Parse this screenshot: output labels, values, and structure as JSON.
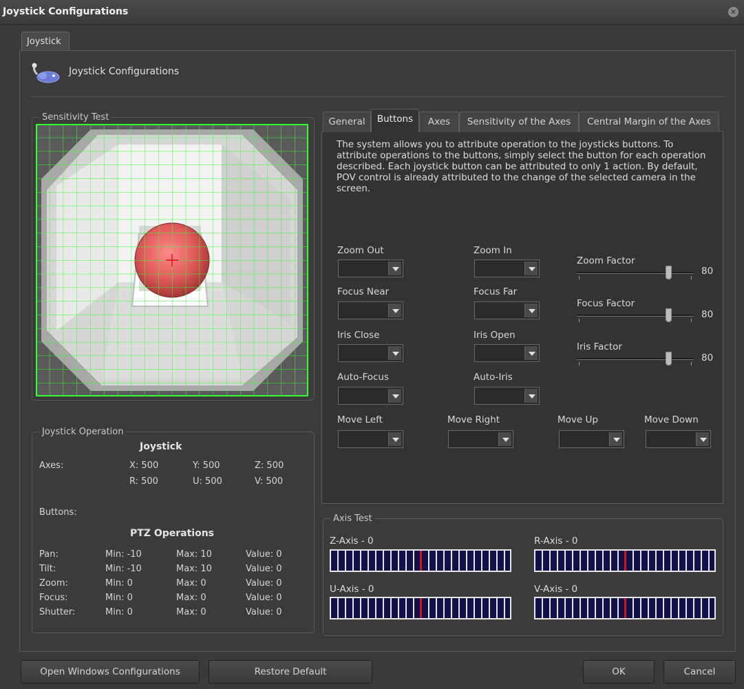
{
  "window": {
    "title": "Joystick Configurations"
  },
  "outer_tab": {
    "label": "Joystick"
  },
  "header": {
    "label": "Joystick Configurations",
    "icon": "joystick-icon"
  },
  "sensitivity": {
    "legend": "Sensitivity Test",
    "grid_color": "#33ff33",
    "cursor_color": "#e85555"
  },
  "operation": {
    "legend": "Joystick Operation",
    "joystick_heading": "Joystick",
    "axes_label": "Axes:",
    "axes": {
      "x": "X: 500",
      "y": "Y: 500",
      "z": "Z: 500",
      "r": "R: 500",
      "u": "U: 500",
      "v": "V: 500"
    },
    "buttons_label": "Buttons:",
    "ptz_heading": "PTZ Operations",
    "ptz_rows": [
      {
        "name": "Pan:",
        "min": "Min: -10",
        "max": "Max: 10",
        "value": "Value: 0"
      },
      {
        "name": "Tilt:",
        "min": "Min: -10",
        "max": "Max: 10",
        "value": "Value: 0"
      },
      {
        "name": "Zoom:",
        "min": "Min: 0",
        "max": "Max: 0",
        "value": "Value: 0"
      },
      {
        "name": "Focus:",
        "min": "Min: 0",
        "max": "Max: 0",
        "value": "Value: 0"
      },
      {
        "name": "Shutter:",
        "min": "Min: 0",
        "max": "Max: 0",
        "value": "Value: 0"
      }
    ]
  },
  "tabs": [
    {
      "label": "General"
    },
    {
      "label": "Buttons",
      "active": true
    },
    {
      "label": "Axes"
    },
    {
      "label": "Sensitivity of the Axes"
    },
    {
      "label": "Central Margin of the Axes"
    }
  ],
  "buttons_tab": {
    "description": "The system allows you to attribute operation to the joysticks buttons. To attribute operations to the buttons, simply select the button for each operation described. Each joystick button can be attributed to only 1 action. By default, POV control is already attributed to the change of the selected camera in the screen.",
    "fields": {
      "zoom_out": "Zoom Out",
      "zoom_in": "Zoom In",
      "focus_near": "Focus Near",
      "focus_far": "Focus Far",
      "iris_close": "Iris Close",
      "iris_open": "Iris Open",
      "auto_focus": "Auto-Focus",
      "auto_iris": "Auto-Iris",
      "move_left": "Move Left",
      "move_right": "Move Right",
      "move_up": "Move Up",
      "move_down": "Move Down"
    },
    "sliders": {
      "zoom": {
        "label": "Zoom Factor",
        "value": "80",
        "fraction": 0.8
      },
      "focus": {
        "label": "Focus Factor",
        "value": "80",
        "fraction": 0.8
      },
      "iris": {
        "label": "Iris Factor",
        "value": "80",
        "fraction": 0.8
      }
    }
  },
  "axis_test": {
    "legend": "Axis Test",
    "z": {
      "label": "Z-Axis - 0",
      "fraction": 0.5
    },
    "r": {
      "label": "R-Axis - 0",
      "fraction": 0.5
    },
    "u": {
      "label": "U-Axis - 0",
      "fraction": 0.5
    },
    "v": {
      "label": "V-Axis - 0",
      "fraction": 0.5
    }
  },
  "footer": {
    "open_windows_config": "Open Windows Configurations",
    "restore_default": "Restore Default",
    "ok": "OK",
    "cancel": "Cancel"
  }
}
